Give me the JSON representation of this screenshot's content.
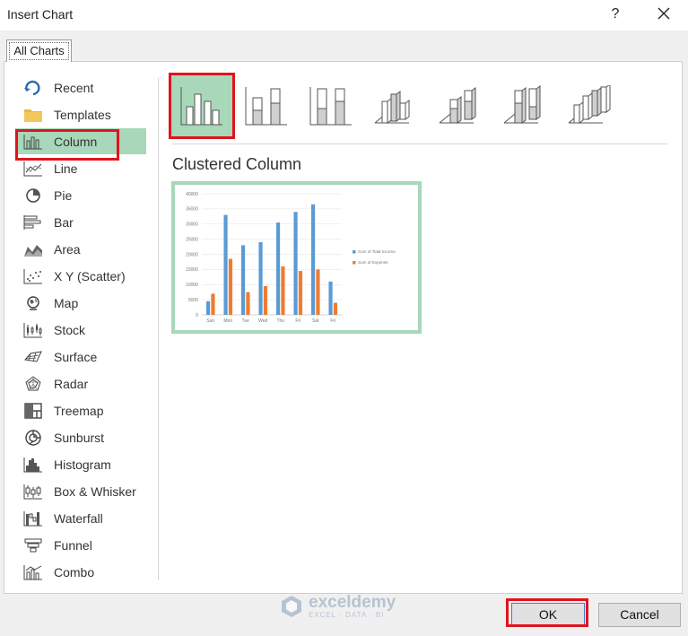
{
  "window": {
    "title": "Insert Chart",
    "help_glyph": "?",
    "close_icon": "close-icon"
  },
  "tabs": [
    {
      "label": "All Charts"
    }
  ],
  "sidebar": {
    "items": [
      {
        "label": "Recent",
        "icon": "recent-icon"
      },
      {
        "label": "Templates",
        "icon": "templates-folder-icon"
      },
      {
        "label": "Column",
        "icon": "column-chart-icon"
      },
      {
        "label": "Line",
        "icon": "line-chart-icon"
      },
      {
        "label": "Pie",
        "icon": "pie-chart-icon"
      },
      {
        "label": "Bar",
        "icon": "bar-chart-icon"
      },
      {
        "label": "Area",
        "icon": "area-chart-icon"
      },
      {
        "label": "X Y (Scatter)",
        "icon": "scatter-chart-icon"
      },
      {
        "label": "Map",
        "icon": "map-chart-icon"
      },
      {
        "label": "Stock",
        "icon": "stock-chart-icon"
      },
      {
        "label": "Surface",
        "icon": "surface-chart-icon"
      },
      {
        "label": "Radar",
        "icon": "radar-chart-icon"
      },
      {
        "label": "Treemap",
        "icon": "treemap-chart-icon"
      },
      {
        "label": "Sunburst",
        "icon": "sunburst-chart-icon"
      },
      {
        "label": "Histogram",
        "icon": "histogram-chart-icon"
      },
      {
        "label": "Box & Whisker",
        "icon": "box-whisker-chart-icon"
      },
      {
        "label": "Waterfall",
        "icon": "waterfall-chart-icon"
      },
      {
        "label": "Funnel",
        "icon": "funnel-chart-icon"
      },
      {
        "label": "Combo",
        "icon": "combo-chart-icon"
      }
    ],
    "selected": "Column"
  },
  "subtypes": {
    "items": [
      {
        "icon": "clustered-column-icon"
      },
      {
        "icon": "stacked-column-icon"
      },
      {
        "icon": "100-stacked-column-icon"
      },
      {
        "icon": "3d-clustered-column-icon"
      },
      {
        "icon": "3d-stacked-column-icon"
      },
      {
        "icon": "3d-100-stacked-column-icon"
      },
      {
        "icon": "3d-column-icon"
      }
    ],
    "selected_title": "Clustered Column"
  },
  "chart_data": {
    "type": "bar",
    "categories": [
      "Sun",
      "Mon",
      "Tue",
      "Wed",
      "Thu",
      "Fri",
      "Sat",
      "Fri"
    ],
    "series": [
      {
        "name": "Sum of Total Income",
        "color": "#5b9bd5",
        "values": [
          4500,
          33000,
          23000,
          24000,
          30500,
          34000,
          36500,
          11000
        ]
      },
      {
        "name": "Sum of Expense",
        "color": "#ed7d31",
        "values": [
          7000,
          18500,
          7500,
          9500,
          16000,
          14500,
          15000,
          4000
        ]
      }
    ],
    "yticks": [
      "0",
      "5000",
      "10000",
      "15000",
      "20000",
      "25000",
      "30000",
      "35000",
      "40000"
    ],
    "ylim": [
      0,
      40000
    ],
    "grid": true,
    "legend": "right"
  },
  "footer": {
    "ok_label": "OK",
    "cancel_label": "Cancel"
  },
  "watermark": {
    "name": "exceldemy",
    "tagline": "EXCEL · DATA · BI"
  },
  "colors": {
    "selected_bg": "#a8d7b9",
    "highlight": "#e0141e"
  }
}
